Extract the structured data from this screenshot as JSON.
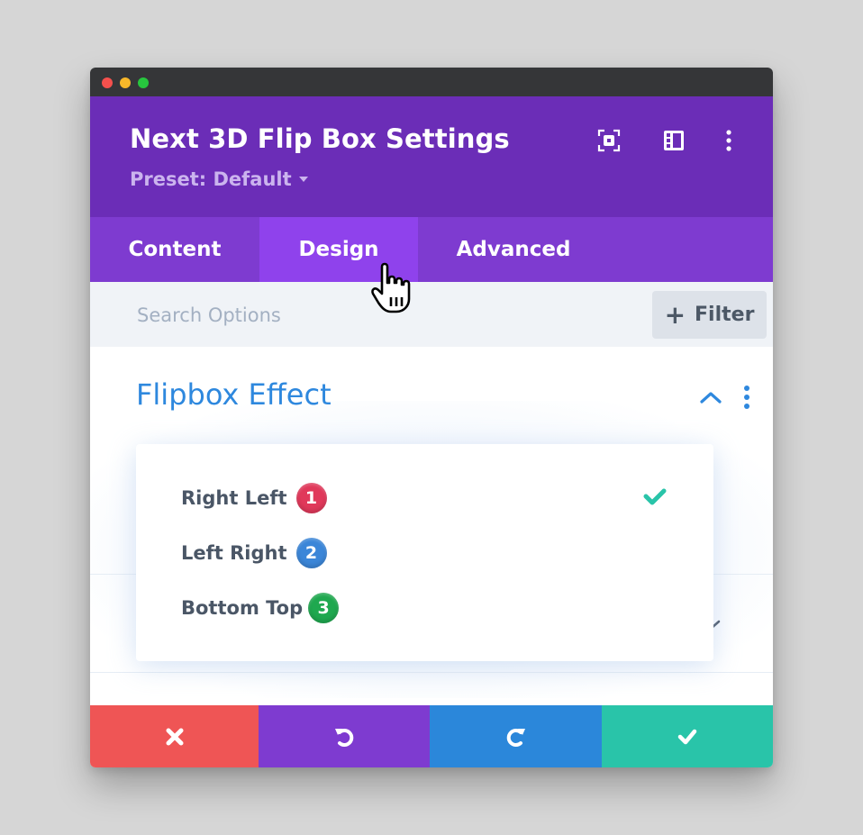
{
  "window": {
    "title": "Next 3D Flip Box Settings",
    "preset_label": "Preset: Default"
  },
  "header_icons": [
    "fullscreen-icon",
    "layout-icon",
    "more-vertical-icon"
  ],
  "tabs": [
    {
      "label": "Content",
      "active": false
    },
    {
      "label": "Design",
      "active": true
    },
    {
      "label": "Advanced",
      "active": false
    }
  ],
  "search": {
    "placeholder": "Search Options",
    "value": ""
  },
  "filter": {
    "label": "Filter"
  },
  "section": {
    "title": "Flipbox Effect",
    "expanded": true
  },
  "dropdown": {
    "selected_index": 0,
    "options": [
      {
        "label": "Right Left",
        "badge": "1",
        "badge_color": "#e0385a"
      },
      {
        "label": "Left Right",
        "badge": "2",
        "badge_color": "#3b86d8"
      },
      {
        "label": "Bottom Top",
        "badge": "3",
        "badge_color": "#1fa84f"
      }
    ]
  },
  "footer": {
    "buttons": [
      {
        "action": "cancel",
        "color": "#ef5555"
      },
      {
        "action": "undo",
        "color": "#7e3bd0"
      },
      {
        "action": "redo",
        "color": "#2b87da"
      },
      {
        "action": "save",
        "color": "#29c4a9"
      }
    ]
  },
  "colors": {
    "header_bg": "#6b2db7",
    "tabs_bg": "#7e3bd0",
    "active_tab_bg": "#8f42ec",
    "accent_blue": "#2e88de",
    "check_teal": "#29c4a9"
  }
}
